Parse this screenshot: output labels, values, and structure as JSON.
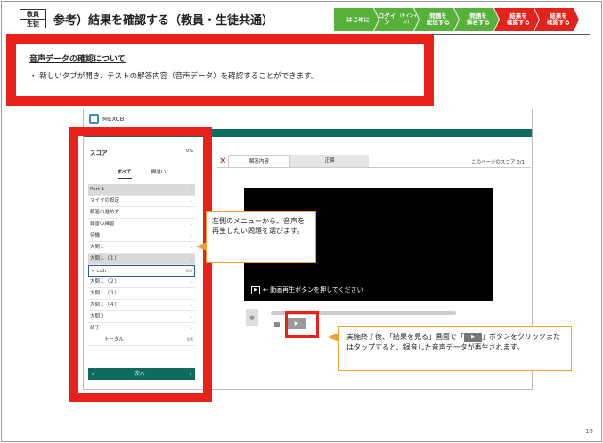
{
  "header": {
    "tag_line1": "教員",
    "tag_line2": "生徒",
    "title": "参考）結果を確認する（教員・生徒共通）",
    "steps": [
      {
        "label": "はじめに",
        "sub": "",
        "color": "#57b03a"
      },
      {
        "label": "ログイン",
        "sub": "（サインイン）",
        "color": "#57b03a"
      },
      {
        "label": "問題を\n配信する",
        "sub": "",
        "color": "#57b03a"
      },
      {
        "label": "問題を\n解答する",
        "sub": "",
        "color": "#57b03a"
      },
      {
        "label": "結果を\n確認する",
        "sub": "",
        "color": "#e0241c"
      },
      {
        "label": "結果を\n確認する",
        "sub": "",
        "color": "#e0241c"
      }
    ]
  },
  "intro": {
    "heading": "音声データの確認について",
    "bullet": "新しいタブが開き、テストの解答内容（音声データ）を確認することができます。"
  },
  "app": {
    "logo": "MEXCBT",
    "score_label": "スコア",
    "score_pct": "0%",
    "tab_all": "すべて",
    "tab_wrong": "間違い",
    "menu": [
      {
        "label": "Part-1",
        "style": "grey"
      },
      {
        "label": "マイクの設定",
        "style": ""
      },
      {
        "label": "解答の進め方",
        "style": ""
      },
      {
        "label": "録音の練習",
        "style": ""
      },
      {
        "label": "待機",
        "style": ""
      },
      {
        "label": "大問１",
        "style": ""
      },
      {
        "label": "大問１（１）",
        "style": "grey"
      }
    ],
    "selected_item": {
      "mark": "✕",
      "label": "ccih",
      "frac": "0/4"
    },
    "menu2": [
      {
        "label": "大問１（２）"
      },
      {
        "label": "大問１（３）"
      },
      {
        "label": "大問１（４）"
      },
      {
        "label": "大問２"
      },
      {
        "label": "終了"
      }
    ],
    "total_label": "トータル",
    "total_frac": "0/4",
    "nav_prev": "‹",
    "nav_next_label": "次へ",
    "nav_next": "›",
    "tab_answer": "解答内容",
    "tab_correct": "正解",
    "page_score": "このページのスコア 0/1",
    "video_text": "← 動画再生ボタンを押してください",
    "play_glyph": "▶"
  },
  "callouts": {
    "left": "左側のメニューから、音声を再生したい問題を選びます。",
    "right_1": "実施終了後、「結果を見る」画面で「",
    "right_2": "」ボタンをクリックまたはタップすると、録音した音声データが再生されます。"
  },
  "page_number": "19"
}
